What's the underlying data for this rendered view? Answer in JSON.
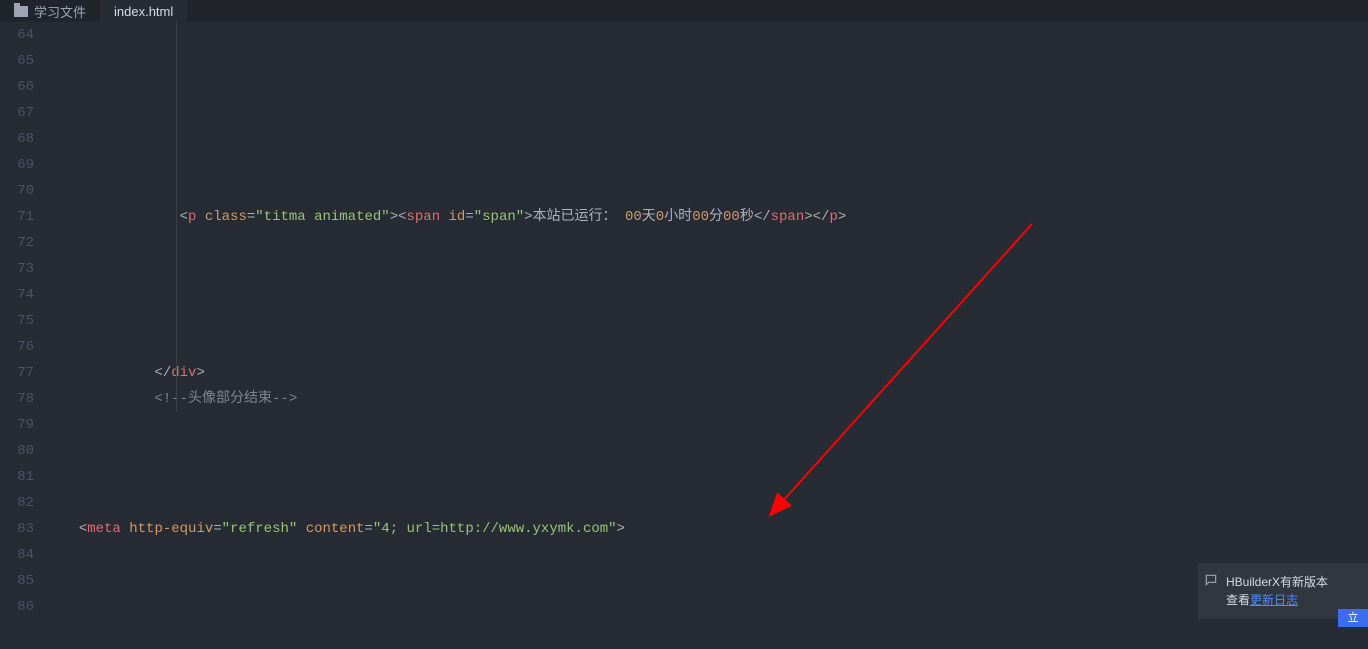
{
  "tabs": {
    "folder_label": "学习文件",
    "file_label": "index.html"
  },
  "line_numbers": [
    "64",
    "65",
    "66",
    "67",
    "68",
    "69",
    "70",
    "71",
    "72",
    "73",
    "74",
    "75",
    "76",
    "77",
    "78",
    "79",
    "80",
    "81",
    "82",
    "83",
    "84",
    "85",
    "86"
  ],
  "code": {
    "line71": {
      "tag_p": "p",
      "attr_class": "class",
      "val_class": "\"titma animated\"",
      "tag_span": "span",
      "attr_id": "id",
      "val_id": "\"span\"",
      "text_prefix": "本站已运行：",
      "text_days": "00",
      "text_day_unit": "天",
      "text_hours": "0",
      "text_hour_unit": "小时",
      "text_mins": "00",
      "text_min_unit": "分",
      "text_secs": "00",
      "text_sec_unit": "秒"
    },
    "line77": {
      "tag_div": "div"
    },
    "line78": {
      "comment": "<!--头像部分结束-->"
    },
    "line83": {
      "tag_meta": "meta",
      "attr_http_equiv": "http-equiv",
      "val_http_equiv": "\"refresh\"",
      "attr_content": "content",
      "val_content": "\"4; url=http://www.yxymk.com\""
    }
  },
  "notification": {
    "line1": "HBuilderX有新版本",
    "line2_prefix": "查看",
    "link_text": "更新日志",
    "button": "立"
  }
}
